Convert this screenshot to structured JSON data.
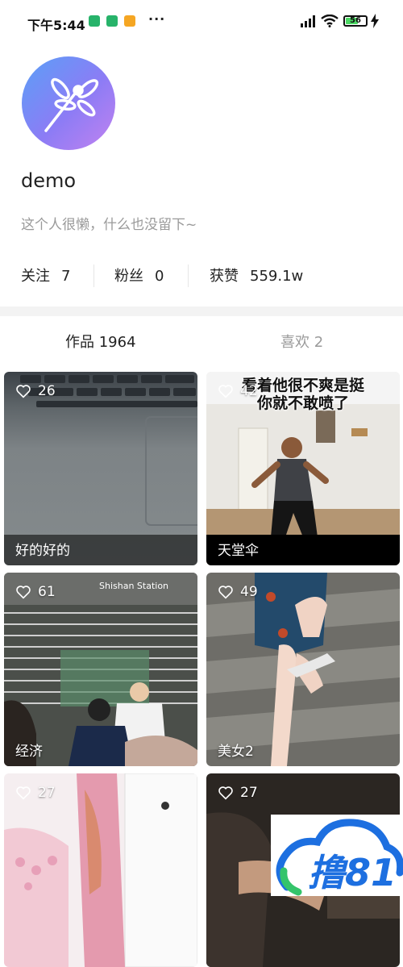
{
  "status_bar": {
    "time": "下午5:44",
    "dots": "···",
    "battery": "56"
  },
  "profile": {
    "username": "demo",
    "bio": "这个人很懒，什么也没留下~",
    "stats": [
      {
        "label": "关注",
        "value": "7"
      },
      {
        "label": "粉丝",
        "value": "0"
      },
      {
        "label": "获赞",
        "value": "559.1w"
      }
    ]
  },
  "tabs": {
    "works": "作品 1964",
    "likes": "喜欢 2"
  },
  "videos": [
    {
      "likes": "26",
      "title": "好的好的"
    },
    {
      "likes": "42",
      "title": "天堂伞",
      "caption_line1": "看着他很不爽是挺",
      "caption_line2": "你就不敢喷了"
    },
    {
      "likes": "61",
      "title": "经济",
      "sign_text": "Shishan Station"
    },
    {
      "likes": "49",
      "title": "美女2"
    },
    {
      "likes": "27",
      "title": ""
    },
    {
      "likes": "27",
      "title": ""
    }
  ],
  "watermark": {
    "text": "撸81"
  },
  "colors": {
    "accent_start": "#5aa0f7",
    "accent_end": "#c282f0",
    "watermark_blue": "#1d6fe0",
    "watermark_green": "#34c46b"
  }
}
